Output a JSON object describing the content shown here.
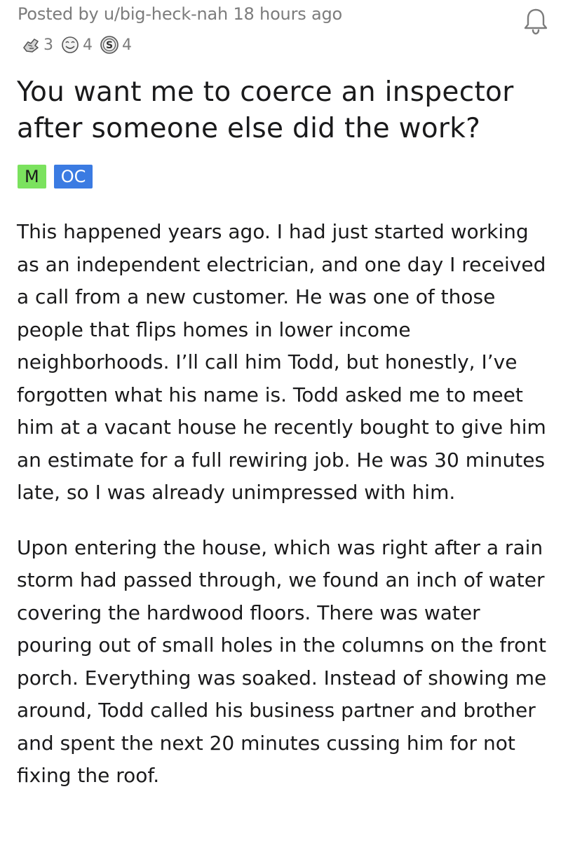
{
  "post": {
    "meta": "Posted by u/big-heck-nah 18 hours ago",
    "awards": [
      {
        "icon": "helpful-award-icon",
        "count": "3"
      },
      {
        "icon": "wholesome-award-icon",
        "count": "4"
      },
      {
        "icon": "silver-award-icon",
        "count": "4"
      }
    ],
    "title": "You want me to coerce an inspector after someone else did the work?",
    "flairs": [
      {
        "label": "M",
        "color": "#7be25e"
      },
      {
        "label": "OC",
        "color": "#3b7be2"
      }
    ],
    "paragraphs": [
      "This happened years ago. I had just started working as an independent electrician, and one day I received a call from a new customer. He was one of those people that flips homes in lower income neighborhoods. I’ll call him Todd, but honestly, I’ve forgotten what his name is. Todd asked me to meet him at a vacant house he recently bought to give him an estimate for a full rewiring job. He was 30 minutes late, so I was already unimpressed with him.",
      "Upon entering the house, which was right after a rain storm had passed through, we found an inch of water covering the hardwood floors. There was water pouring out of small holes in the columns on the front porch. Everything was soaked. Instead of showing me around, Todd called his business partner and brother and spent the next 20 minutes cussing him for not fixing the roof."
    ]
  },
  "icons": {
    "bell": "bell-icon"
  }
}
